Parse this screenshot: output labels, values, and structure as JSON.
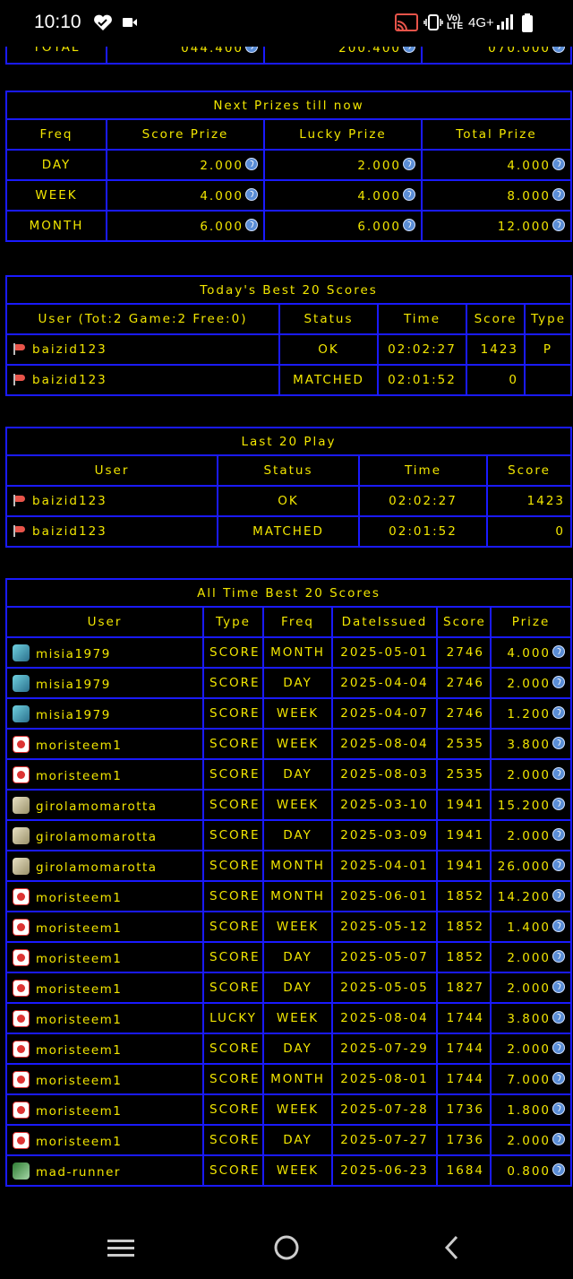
{
  "statusbar": {
    "time": "10:10",
    "network": "4G+",
    "icons": [
      "heart-icon",
      "video-icon",
      "cast-icon",
      "vibrate-icon",
      "volte-icon",
      "signal-icon",
      "battery-icon"
    ]
  },
  "top_partial": {
    "label": "TOTAL",
    "values": [
      "044.400",
      "200.400",
      "070.000"
    ]
  },
  "next_prizes": {
    "title": "Next Prizes till now",
    "headers": [
      "Freq",
      "Score Prize",
      "Lucky Prize",
      "Total Prize"
    ],
    "rows": [
      {
        "freq": "DAY",
        "score": "2.000",
        "lucky": "2.000",
        "total": "4.000"
      },
      {
        "freq": "WEEK",
        "score": "4.000",
        "lucky": "4.000",
        "total": "8.000"
      },
      {
        "freq": "MONTH",
        "score": "6.000",
        "lucky": "6.000",
        "total": "12.000"
      }
    ]
  },
  "today_best": {
    "title": "Today's Best 20 Scores",
    "headers": [
      "User (Tot:2 Game:2 Free:0)",
      "Status",
      "Time",
      "Score",
      "Type"
    ],
    "rows": [
      {
        "user": "baizid123",
        "status": "OK",
        "time": "02:02:27",
        "score": "1423",
        "type": "P"
      },
      {
        "user": "baizid123",
        "status": "MATCHED",
        "time": "02:01:52",
        "score": "0",
        "type": ""
      }
    ]
  },
  "last_play": {
    "title": "Last 20 Play",
    "headers": [
      "User",
      "Status",
      "Time",
      "Score"
    ],
    "rows": [
      {
        "user": "baizid123",
        "status": "OK",
        "time": "02:02:27",
        "score": "1423"
      },
      {
        "user": "baizid123",
        "status": "MATCHED",
        "time": "02:01:52",
        "score": "0"
      }
    ]
  },
  "all_time": {
    "title": "All Time Best 20 Scores",
    "headers": [
      "User",
      "Type",
      "Freq",
      "DateIssued",
      "Score",
      "Prize"
    ],
    "rows": [
      {
        "user": "misia1979",
        "avatar": "misia",
        "type": "SCORE",
        "freq": "MONTH",
        "date": "2025-05-01",
        "score": "2746",
        "prize": "4.000"
      },
      {
        "user": "misia1979",
        "avatar": "misia",
        "type": "SCORE",
        "freq": "DAY",
        "date": "2025-04-04",
        "score": "2746",
        "prize": "2.000"
      },
      {
        "user": "misia1979",
        "avatar": "misia",
        "type": "SCORE",
        "freq": "WEEK",
        "date": "2025-04-07",
        "score": "2746",
        "prize": "1.200"
      },
      {
        "user": "moristeem1",
        "avatar": "mori",
        "type": "SCORE",
        "freq": "WEEK",
        "date": "2025-08-04",
        "score": "2535",
        "prize": "3.800"
      },
      {
        "user": "moristeem1",
        "avatar": "mori",
        "type": "SCORE",
        "freq": "DAY",
        "date": "2025-08-03",
        "score": "2535",
        "prize": "2.000"
      },
      {
        "user": "girolamomarotta",
        "avatar": "giro",
        "type": "SCORE",
        "freq": "WEEK",
        "date": "2025-03-10",
        "score": "1941",
        "prize": "15.200"
      },
      {
        "user": "girolamomarotta",
        "avatar": "giro",
        "type": "SCORE",
        "freq": "DAY",
        "date": "2025-03-09",
        "score": "1941",
        "prize": "2.000"
      },
      {
        "user": "girolamomarotta",
        "avatar": "giro",
        "type": "SCORE",
        "freq": "MONTH",
        "date": "2025-04-01",
        "score": "1941",
        "prize": "26.000"
      },
      {
        "user": "moristeem1",
        "avatar": "mori",
        "type": "SCORE",
        "freq": "MONTH",
        "date": "2025-06-01",
        "score": "1852",
        "prize": "14.200"
      },
      {
        "user": "moristeem1",
        "avatar": "mori",
        "type": "SCORE",
        "freq": "WEEK",
        "date": "2025-05-12",
        "score": "1852",
        "prize": "1.400"
      },
      {
        "user": "moristeem1",
        "avatar": "mori",
        "type": "SCORE",
        "freq": "DAY",
        "date": "2025-05-07",
        "score": "1852",
        "prize": "2.000"
      },
      {
        "user": "moristeem1",
        "avatar": "mori",
        "type": "SCORE",
        "freq": "DAY",
        "date": "2025-05-05",
        "score": "1827",
        "prize": "2.000"
      },
      {
        "user": "moristeem1",
        "avatar": "mori",
        "type": "LUCKY",
        "freq": "WEEK",
        "date": "2025-08-04",
        "score": "1744",
        "prize": "3.800"
      },
      {
        "user": "moristeem1",
        "avatar": "mori",
        "type": "SCORE",
        "freq": "DAY",
        "date": "2025-07-29",
        "score": "1744",
        "prize": "2.000"
      },
      {
        "user": "moristeem1",
        "avatar": "mori",
        "type": "SCORE",
        "freq": "MONTH",
        "date": "2025-08-01",
        "score": "1744",
        "prize": "7.000"
      },
      {
        "user": "moristeem1",
        "avatar": "mori",
        "type": "SCORE",
        "freq": "WEEK",
        "date": "2025-07-28",
        "score": "1736",
        "prize": "1.800"
      },
      {
        "user": "moristeem1",
        "avatar": "mori",
        "type": "SCORE",
        "freq": "DAY",
        "date": "2025-07-27",
        "score": "1736",
        "prize": "2.000"
      },
      {
        "user": "mad-runner",
        "avatar": "mad",
        "type": "SCORE",
        "freq": "WEEK",
        "date": "2025-06-23",
        "score": "1684",
        "prize": "0.800"
      }
    ]
  },
  "navbar": {
    "buttons": [
      "recents-menu-icon",
      "home-circle-icon",
      "back-chevron-icon"
    ]
  }
}
